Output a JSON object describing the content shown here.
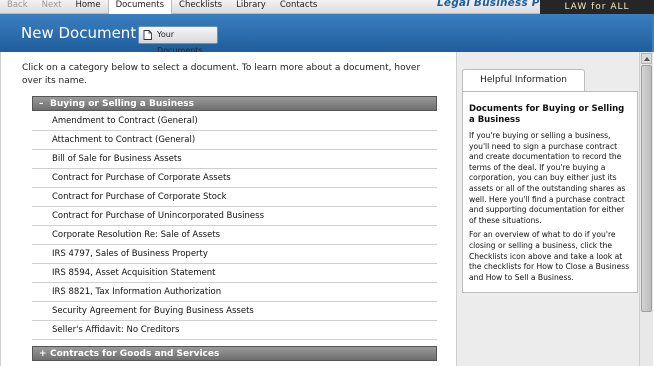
{
  "nav": {
    "items": [
      {
        "label": "Back",
        "state": "disabled"
      },
      {
        "label": "Next",
        "state": "disabled"
      },
      {
        "label": "Home",
        "state": "normal"
      },
      {
        "label": "Documents",
        "state": "active"
      },
      {
        "label": "Checklists",
        "state": "normal"
      },
      {
        "label": "Library",
        "state": "normal"
      },
      {
        "label": "Contacts",
        "state": "normal"
      }
    ],
    "brand": "Legal Business Pro",
    "tagline": "LAW for ALL"
  },
  "header": {
    "title": "New Document",
    "your_documents_label": "Your Documents"
  },
  "main": {
    "instructions": "Click on a category below to select a document. To learn more about a document, hover over its name.",
    "categories": [
      {
        "label": "Buying or Selling a Business",
        "expanded": true,
        "toggle": "–",
        "documents": [
          "Amendment to Contract (General)",
          "Attachment to Contract (General)",
          "Bill of Sale for Business Assets",
          "Contract for Purchase of Corporate Assets",
          "Contract for Purchase of Corporate Stock",
          "Contract for Purchase of Unincorporated Business",
          "Corporate Resolution Re: Sale of Assets",
          "IRS 4797, Sales of Business Property",
          "IRS 8594, Asset Acquisition Statement",
          "IRS 8821, Tax Information Authorization",
          "Security Agreement for Buying Business Assets",
          "Seller's Affidavit: No Creditors"
        ]
      },
      {
        "label": "Contracts for Goods and Services",
        "expanded": false,
        "toggle": "+"
      }
    ]
  },
  "help": {
    "tab_label": "Helpful Information",
    "heading": "Documents for Buying or Selling a Business",
    "paragraph1": "If you're buying or selling a business, you'll need to sign a purchase contract and create documentation to record the terms of the deal. If you're buying a corporation, you can buy either just its assets or all of the outstanding shares as well. Here you'll find a purchase contract and supporting documentation for either of these situations.",
    "paragraph2": "For an overview of what to do if you're closing or selling a business, click the Checklists icon above and take a look at the checklists for How to Close a Business and How to Sell a Business."
  },
  "colors": {
    "header_blue": "#2a6dae",
    "brand_blue": "#1f5e9e",
    "category_gray": "#7f7f7f"
  }
}
